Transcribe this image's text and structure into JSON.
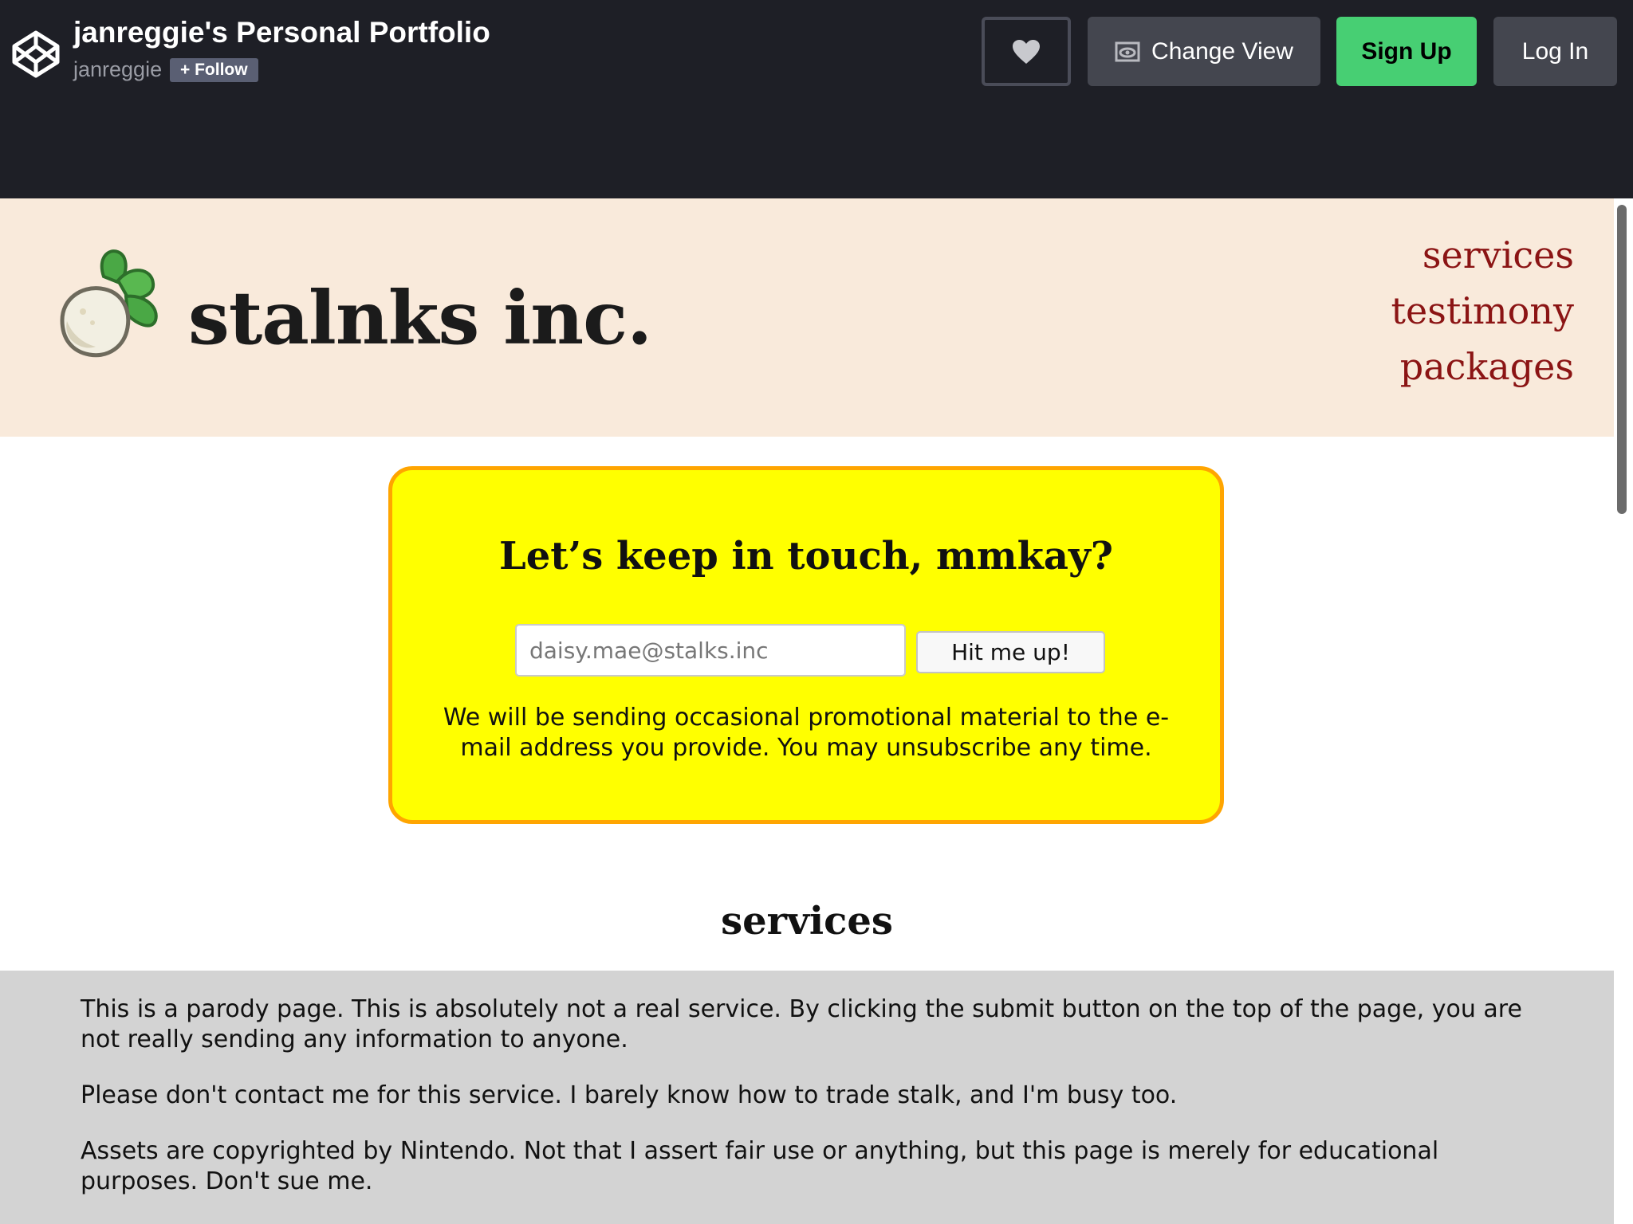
{
  "codepen": {
    "pen_title": "janreggie's Personal Portfolio",
    "author": "janreggie",
    "follow_label": "+ Follow",
    "change_view_label": "Change View",
    "sign_up_label": "Sign Up",
    "log_in_label": "Log In",
    "icons": [
      "codepen-logo-icon",
      "heart-icon",
      "eye-icon"
    ]
  },
  "site": {
    "brand": "stalnks inc.",
    "logo_icon": "turnip-icon",
    "nav": [
      "services",
      "testimony",
      "packages"
    ],
    "colors": {
      "header_bg": "#f9eadb",
      "nav_link": "#8b1414",
      "box_bg": "#ffff00",
      "box_border": "#ffa500"
    }
  },
  "signup": {
    "heading": "Let’s keep in touch, mmkay?",
    "email_placeholder": "daisy.mae@stalks.inc",
    "submit_label": "Hit me up!",
    "note": "We will be sending occasional promotional material to the e-mail address you provide. You may unsubscribe any time."
  },
  "services": {
    "title": "services",
    "paragraphs": [
      "This is a parody page. This is absolutely not a real service. By clicking the submit button on the top of the page, you are not really sending any information to anyone.",
      "Please don't contact me for this service. I barely know how to trade stalk, and I'm busy too.",
      "Assets are copyrighted by Nintendo. Not that I assert fair use or anything, but this page is merely for educational purposes. Don't sue me."
    ]
  }
}
